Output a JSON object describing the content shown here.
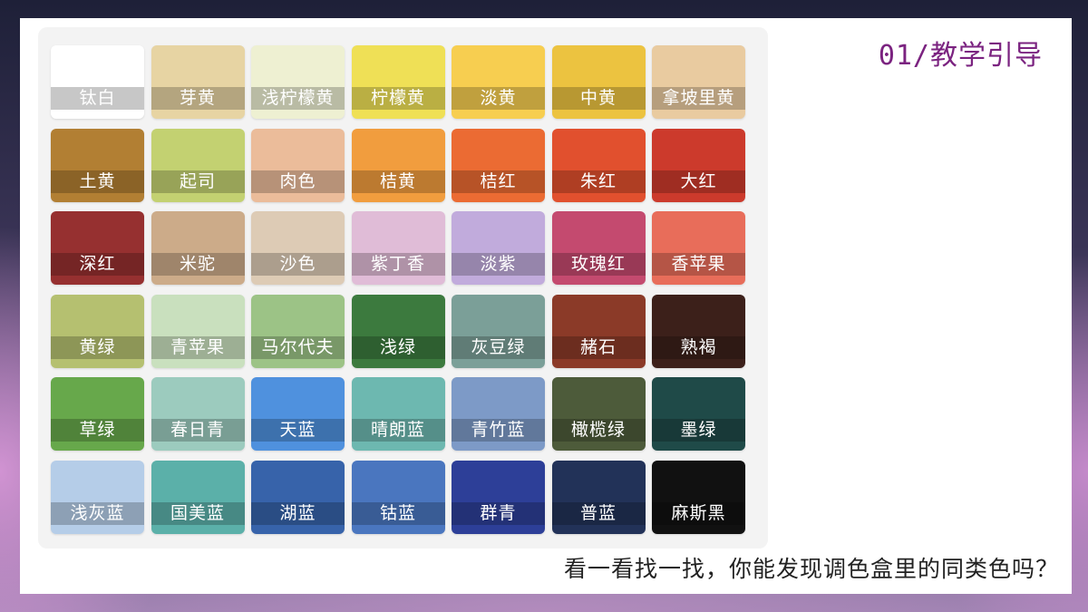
{
  "title": "01/教学引导",
  "caption": "看一看找一找，你能发现调色盒里的同类色吗？",
  "swatches": [
    {
      "label": "钛白",
      "color": "#ffffff"
    },
    {
      "label": "芽黄",
      "color": "#e7d4a3"
    },
    {
      "label": "浅柠檬黄",
      "color": "#eef0d2"
    },
    {
      "label": "柠檬黄",
      "color": "#efe056"
    },
    {
      "label": "淡黄",
      "color": "#f7ce50"
    },
    {
      "label": "中黄",
      "color": "#ecc340"
    },
    {
      "label": "拿坡里黄",
      "color": "#e9cba0"
    },
    {
      "label": "土黄",
      "color": "#b27f33"
    },
    {
      "label": "起司",
      "color": "#c3d171"
    },
    {
      "label": "肉色",
      "color": "#ebbc9a"
    },
    {
      "label": "桔黄",
      "color": "#f19d3e"
    },
    {
      "label": "桔红",
      "color": "#eb6b33"
    },
    {
      "label": "朱红",
      "color": "#e1502e"
    },
    {
      "label": "大红",
      "color": "#cc3a2c"
    },
    {
      "label": "深红",
      "color": "#963030"
    },
    {
      "label": "米驼",
      "color": "#ccab89"
    },
    {
      "label": "沙色",
      "color": "#ddcbb5"
    },
    {
      "label": "紫丁香",
      "color": "#e0bcd7"
    },
    {
      "label": "淡紫",
      "color": "#c1abdc"
    },
    {
      "label": "玫瑰红",
      "color": "#c44a6f"
    },
    {
      "label": "香苹果",
      "color": "#e86d5a"
    },
    {
      "label": "黄绿",
      "color": "#b5c070"
    },
    {
      "label": "青苹果",
      "color": "#c9e0be"
    },
    {
      "label": "马尔代夫",
      "color": "#9cc386"
    },
    {
      "label": "浅绿",
      "color": "#3c7a3e"
    },
    {
      "label": "灰豆绿",
      "color": "#7b9f98"
    },
    {
      "label": "赭石",
      "color": "#8b3a28"
    },
    {
      "label": "熟褐",
      "color": "#3c201a"
    },
    {
      "label": "草绿",
      "color": "#67a84b"
    },
    {
      "label": "春日青",
      "color": "#9ccbbe"
    },
    {
      "label": "天蓝",
      "color": "#4f91de"
    },
    {
      "label": "晴朗蓝",
      "color": "#6db8b0"
    },
    {
      "label": "青竹蓝",
      "color": "#7d9ac7"
    },
    {
      "label": "橄榄绿",
      "color": "#4d5b3a"
    },
    {
      "label": "墨绿",
      "color": "#1f4a48"
    },
    {
      "label": "浅灰蓝",
      "color": "#b5cde8"
    },
    {
      "label": "国美蓝",
      "color": "#5bb0a9"
    },
    {
      "label": "湖蓝",
      "color": "#3763aa"
    },
    {
      "label": "钴蓝",
      "color": "#4a76bf"
    },
    {
      "label": "群青",
      "color": "#2d3f98"
    },
    {
      "label": "普蓝",
      "color": "#223258"
    },
    {
      "label": "麻斯黑",
      "color": "#111111"
    }
  ]
}
